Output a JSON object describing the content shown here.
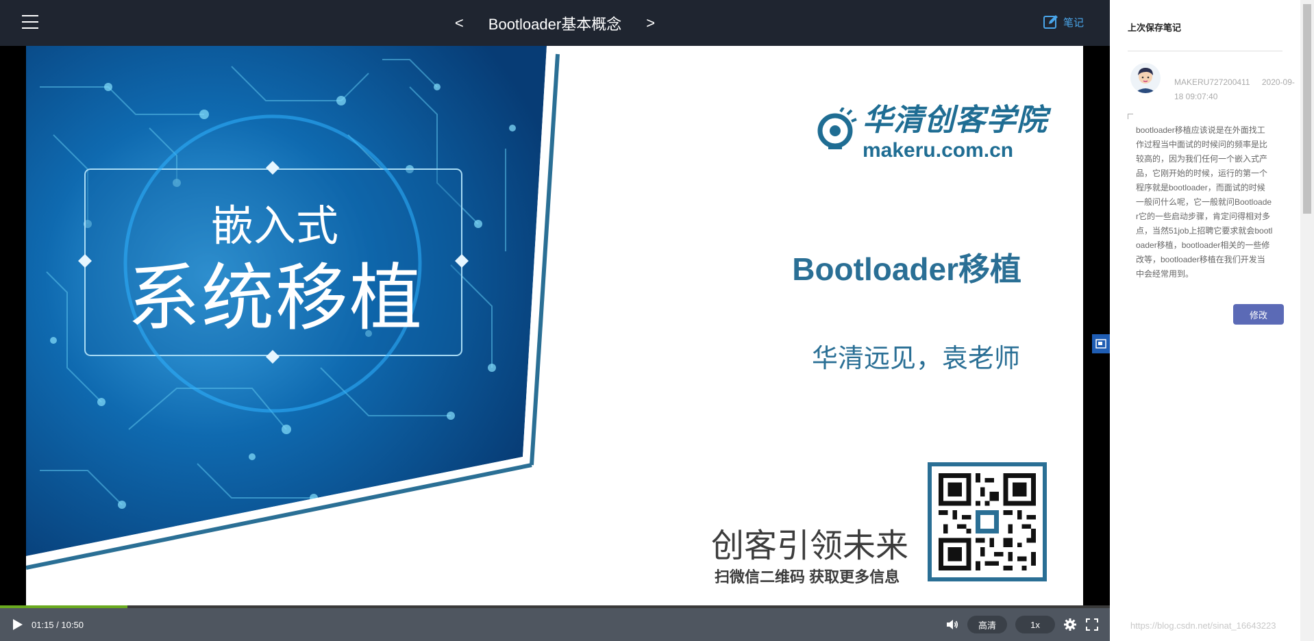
{
  "topbar": {
    "title": "Bootloader基本概念",
    "prev_label": "<",
    "next_label": ">",
    "note_label": "笔记",
    "menu_icon": "hamburger-menu-icon",
    "note_icon": "edit-note-icon",
    "background_color": "#1f2530",
    "accent_color": "#4aa6ea"
  },
  "slide": {
    "box_line1": "嵌入式",
    "box_line2": "系统移植",
    "logo_name": "华清创客学院",
    "logo_url": "makeru.com.cn",
    "course_name": "Bootloader移植",
    "teacher": "华清远见，袁老师",
    "slogan": "创客引领未来",
    "slogan_sub": "扫微信二维码  获取更多信息",
    "brand_color": "#2a6f95"
  },
  "player": {
    "current_time": "01:15",
    "duration": "10:50",
    "progress_percent": 11.5,
    "quality_label": "高清",
    "speed_label": "1x",
    "progress_color": "#6aaa1f"
  },
  "notes": {
    "title": "上次保存笔记",
    "user": "MAKERU727200411",
    "timestamp": "2020-09-18 09:07:40",
    "body": "bootloader移植应该说是在外面找工作过程当中面试的时候问的频率是比较高的，因为我们任何一个嵌入式产品，它刚开始的时候，运行的第一个程序就是bootloader，而面试的时候一般问什么呢，它一般就问Bootloader它的一些启动步骤，肯定问得相对多点，当然51job上招聘它要求就会bootloader移植，bootloader相关的一些修改等，bootloader移植在我们开发当中会经常用到。",
    "modify_label": "修改",
    "button_color": "#5b6ab6"
  },
  "watermark": "https://blog.csdn.net/sinat_16643223"
}
